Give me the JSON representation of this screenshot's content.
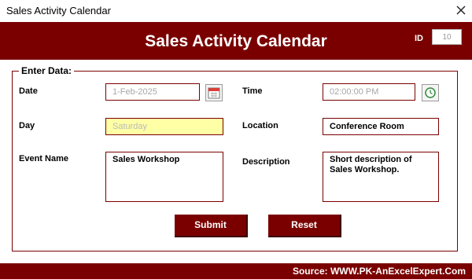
{
  "window": {
    "title": "Sales Activity Calendar",
    "close_icon": "close-icon"
  },
  "header": {
    "title": "Sales Activity Calendar",
    "id_label": "ID",
    "id_value": "10"
  },
  "form": {
    "group_title": "Enter Data:",
    "date": {
      "label": "Date",
      "value": "1-Feb-2025",
      "icon": "calendar-icon"
    },
    "time": {
      "label": "Time",
      "value": "02:00:00 PM",
      "icon": "clock-icon"
    },
    "day": {
      "label": "Day",
      "value": "Saturday"
    },
    "location": {
      "label": "Location",
      "value": "Conference Room"
    },
    "event_name": {
      "label": "Event Name",
      "value": "Sales Workshop"
    },
    "description": {
      "label": "Description",
      "value": "Short description of Sales Workshop."
    }
  },
  "buttons": {
    "submit": "Submit",
    "reset": "Reset"
  },
  "footer": {
    "source": "Source: WWW.PK-AnExcelExpert.Com"
  },
  "colors": {
    "accent": "#7a0000",
    "day_field_bg": "#ffffa6"
  }
}
